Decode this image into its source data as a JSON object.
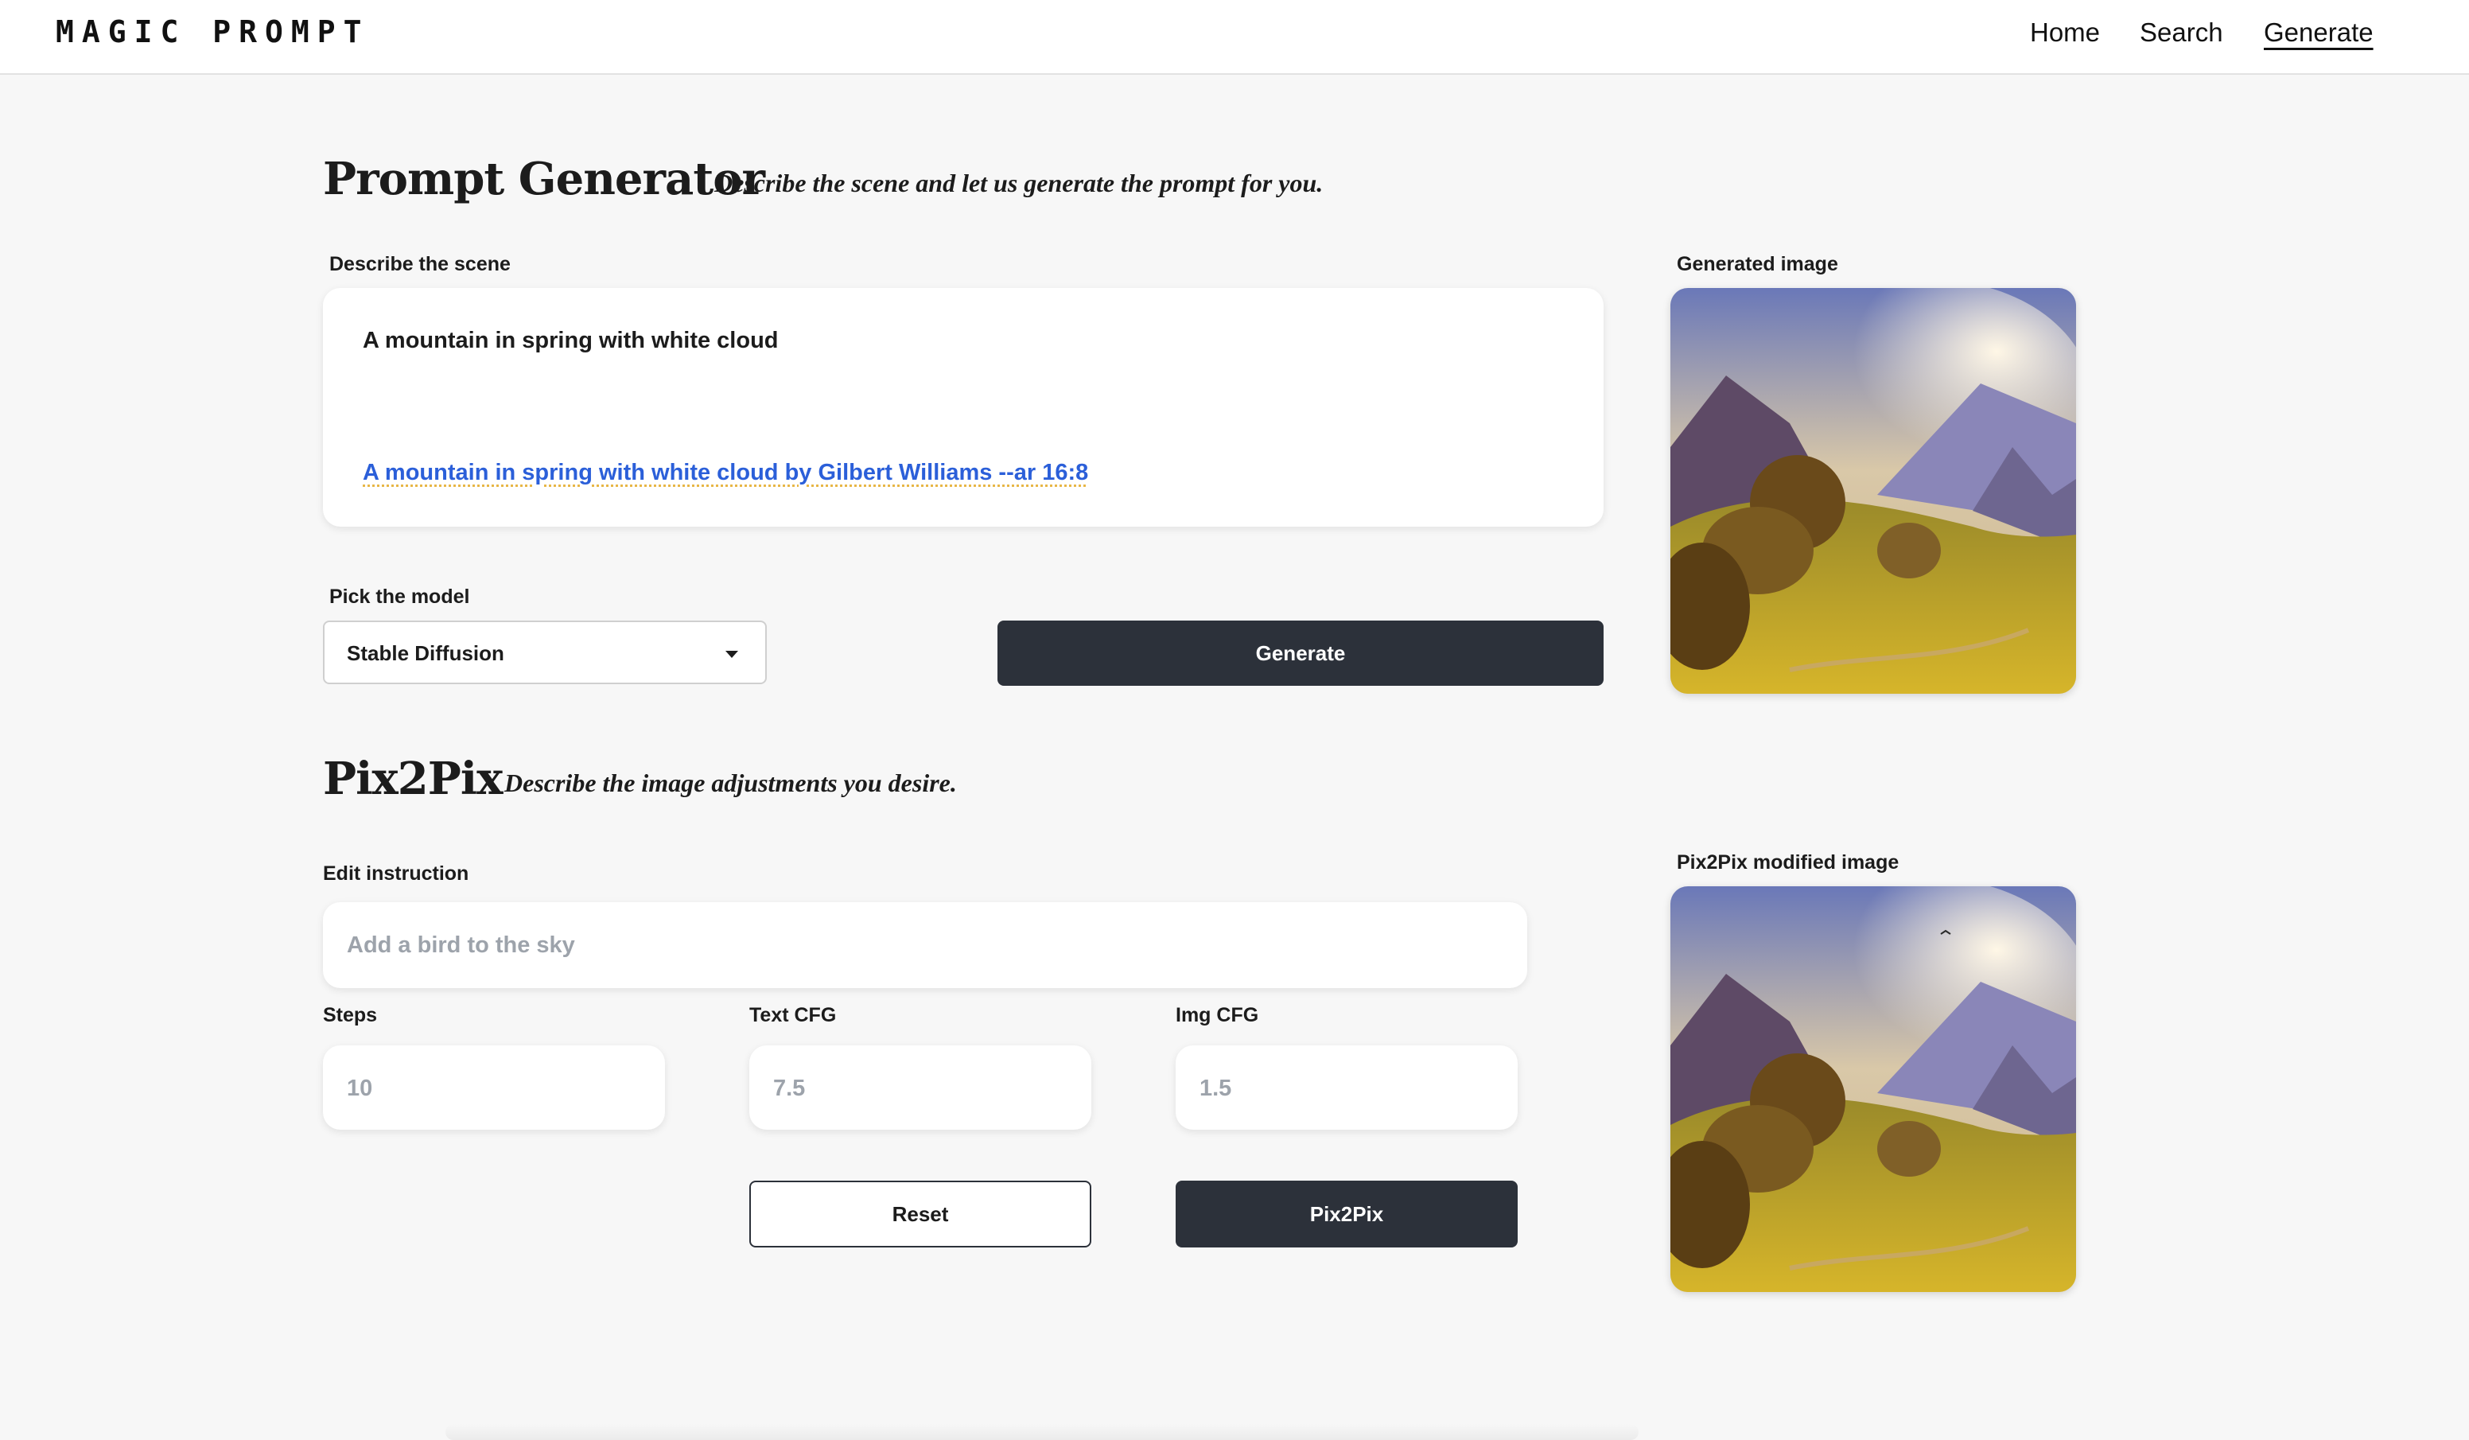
{
  "app": {
    "logo": "MAGIC PROMPT"
  },
  "nav": {
    "items": [
      "Home",
      "Search",
      "Generate"
    ],
    "active": "Generate"
  },
  "prompt_generator": {
    "title": "Prompt Generator",
    "subtitle": "Describe the scene and let us generate the prompt for you.",
    "scene_label": "Describe the scene",
    "scene_value": "A mountain in spring with white cloud",
    "suggestion": "A mountain in spring with white cloud by Gilbert Williams --ar 16:8",
    "model_label": "Pick the model",
    "model_value": "Stable Diffusion",
    "generate_label": "Generate",
    "image_label": "Generated image"
  },
  "pix2pix": {
    "title": "Pix2Pix",
    "subtitle": "Describe the image adjustments you desire.",
    "edit_label": "Edit instruction",
    "edit_placeholder": "Add a bird to the sky",
    "steps_label": "Steps",
    "steps_placeholder": "10",
    "text_cfg_label": "Text CFG",
    "text_cfg_placeholder": "7.5",
    "img_cfg_label": "Img CFG",
    "img_cfg_placeholder": "1.5",
    "reset_label": "Reset",
    "run_label": "Pix2Pix",
    "image_label": "Pix2Pix modified image"
  },
  "colors": {
    "dark_button": "#2c313a",
    "suggestion_link": "#2b5fd9",
    "background": "#f7f7f7"
  }
}
